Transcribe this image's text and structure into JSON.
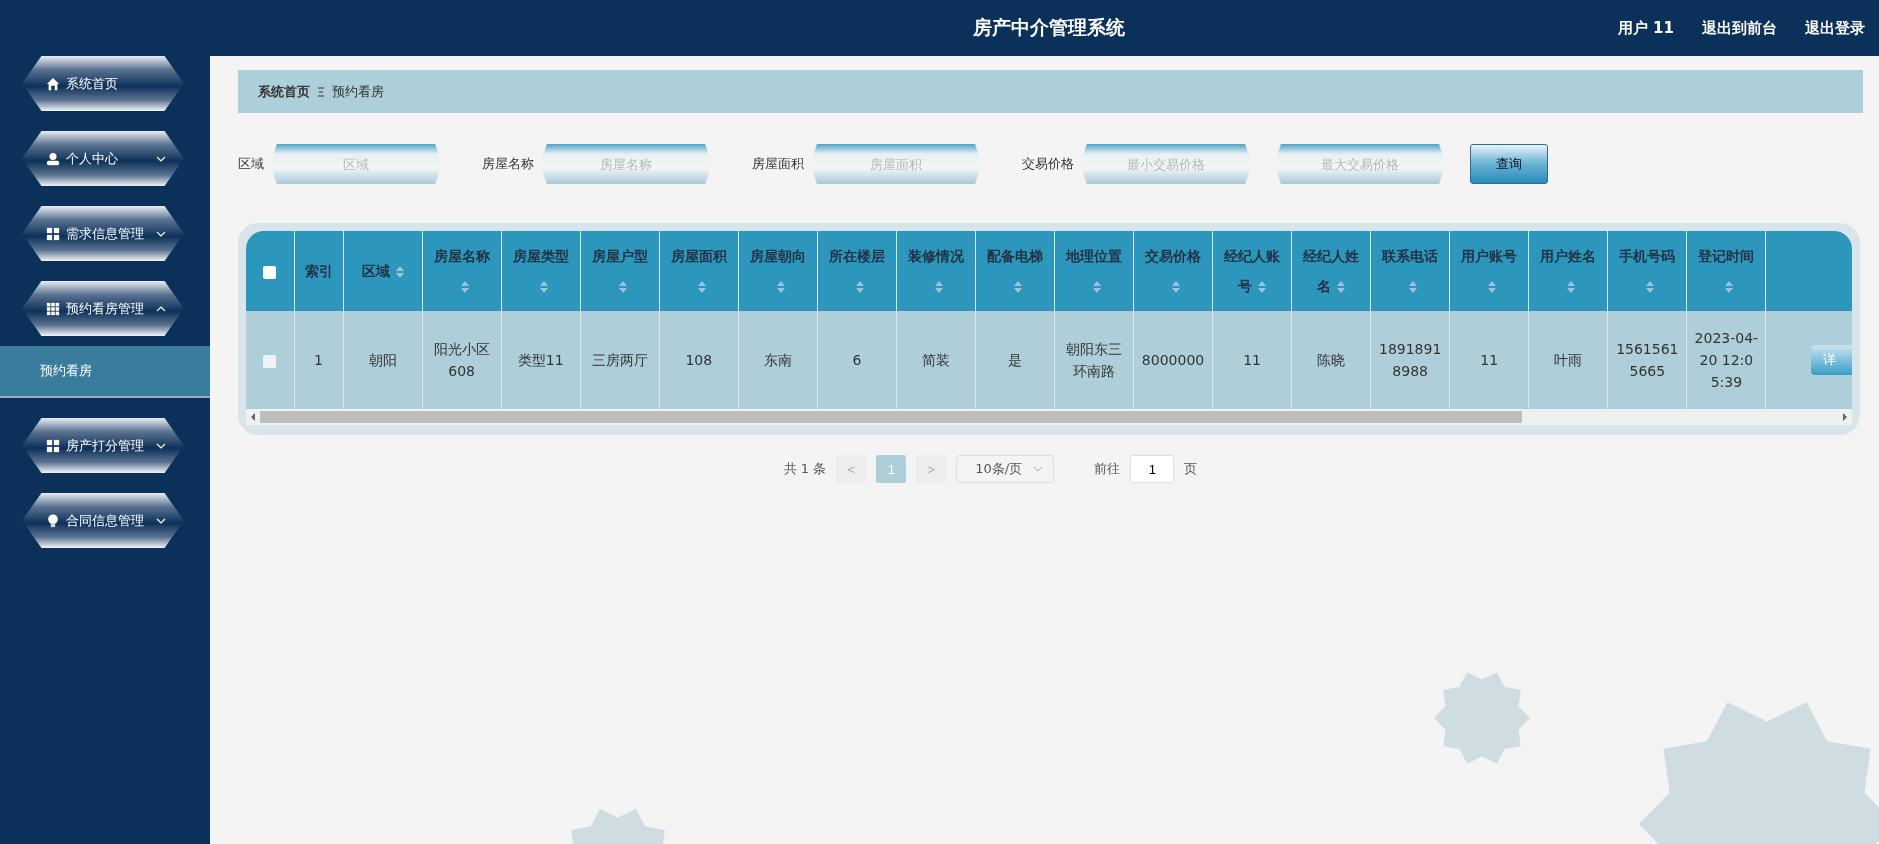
{
  "header": {
    "title": "房产中介管理系统",
    "user": "用户 11",
    "links": [
      "退出到前台",
      "退出登录"
    ]
  },
  "sidebar": {
    "items": [
      {
        "label": "系统首页",
        "kind": "house"
      },
      {
        "label": "个人中心",
        "kind": "person",
        "expanded": false
      },
      {
        "label": "需求信息管理",
        "kind": "grid",
        "expanded": false
      },
      {
        "label": "预约看房管理",
        "kind": "grid9",
        "expanded": true,
        "children": [
          {
            "label": "预约看房",
            "selected": true
          }
        ]
      },
      {
        "label": "房产打分管理",
        "kind": "grid",
        "expanded": false
      },
      {
        "label": "合同信息管理",
        "kind": "bulb",
        "expanded": false
      }
    ]
  },
  "breadcrumb": [
    "系统首页",
    "预约看房"
  ],
  "filters": [
    {
      "label": "区域",
      "fields": [
        {
          "placeholder": "区域"
        }
      ]
    },
    {
      "label": "房屋名称",
      "fields": [
        {
          "placeholder": "房屋名称"
        }
      ]
    },
    {
      "label": "房屋面积",
      "fields": [
        {
          "placeholder": "房屋面积"
        }
      ]
    },
    {
      "label": "交易价格",
      "fields": [
        {
          "placeholder": "最小交易价格"
        },
        {
          "placeholder": "最大交易价格"
        }
      ]
    }
  ],
  "search_button": "查询",
  "table": {
    "select_all": false,
    "columns": [
      {
        "label": "索引",
        "sortable": false
      },
      {
        "label": "区域",
        "sortable": true
      },
      {
        "label": "房屋名称",
        "sortable": true
      },
      {
        "label": "房屋类型",
        "sortable": true
      },
      {
        "label": "房屋户型",
        "sortable": true
      },
      {
        "label": "房屋面积",
        "sortable": true
      },
      {
        "label": "房屋朝向",
        "sortable": true
      },
      {
        "label": "所在楼层",
        "sortable": true
      },
      {
        "label": "装修情况",
        "sortable": true
      },
      {
        "label": "配备电梯",
        "sortable": true
      },
      {
        "label": "地理位置",
        "sortable": true
      },
      {
        "label": "交易价格",
        "sortable": true
      },
      {
        "label": "经纪人账号",
        "sortable": true
      },
      {
        "label": "经纪人姓名",
        "sortable": true
      },
      {
        "label": "联系电话",
        "sortable": true
      },
      {
        "label": "用户账号",
        "sortable": true
      },
      {
        "label": "用户姓名",
        "sortable": true
      },
      {
        "label": "手机号码",
        "sortable": true
      },
      {
        "label": "登记时间",
        "sortable": true
      }
    ],
    "rows": [
      {
        "selected": false,
        "cells": [
          "1",
          "朝阳",
          "阳光小区608",
          "类型11",
          "三房两厅",
          "108",
          "东南",
          "6",
          "简装",
          "是",
          "朝阳东三环南路",
          "8000000",
          "11",
          "陈晓",
          "18918918988",
          "11",
          "叶雨",
          "15615615665",
          "2023-04-20 12:05:39"
        ],
        "action": "详"
      }
    ]
  },
  "pagination": {
    "total": "共 1 条",
    "prev": "<",
    "pages": [
      {
        "label": "1",
        "selected": true
      }
    ],
    "next": ">",
    "page_size": "10条/页",
    "goto_label": "前往",
    "goto_value": "1",
    "goto_suffix": "页"
  }
}
